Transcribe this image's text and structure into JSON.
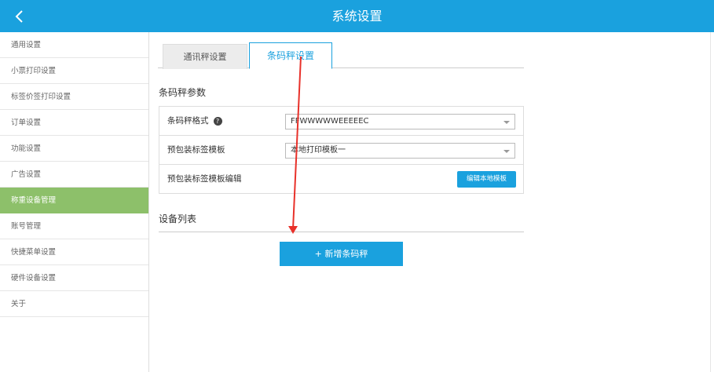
{
  "header": {
    "title": "系统设置",
    "back_icon": "chevron-left-icon"
  },
  "sidebar": {
    "items": [
      {
        "label": "通用设置"
      },
      {
        "label": "小票打印设置"
      },
      {
        "label": "标签价签打印设置"
      },
      {
        "label": "订单设置"
      },
      {
        "label": "功能设置"
      },
      {
        "label": "广告设置"
      },
      {
        "label": "称重设备管理",
        "active": true
      },
      {
        "label": "账号管理"
      },
      {
        "label": "快捷菜单设置"
      },
      {
        "label": "硬件设备设置"
      },
      {
        "label": "关于"
      }
    ]
  },
  "tabs": [
    {
      "label": "通讯秤设置",
      "active": false
    },
    {
      "label": "条码秤设置",
      "active": true
    }
  ],
  "params": {
    "title": "条码秤参数",
    "barcode_format_label": "条码秤格式",
    "barcode_format_value": "FFWWWWWEEEEEC",
    "template_label": "预包装标签模板",
    "template_value": "本地打印模板一",
    "template_edit_label": "预包装标签模板编辑",
    "edit_button": "编辑本地模板"
  },
  "devices": {
    "title": "设备列表",
    "add_button": "+ 新增条码秤"
  },
  "colors": {
    "accent": "#1aa1de",
    "active_sidebar": "#8dc06a",
    "annotation_arrow": "#e8312a"
  }
}
